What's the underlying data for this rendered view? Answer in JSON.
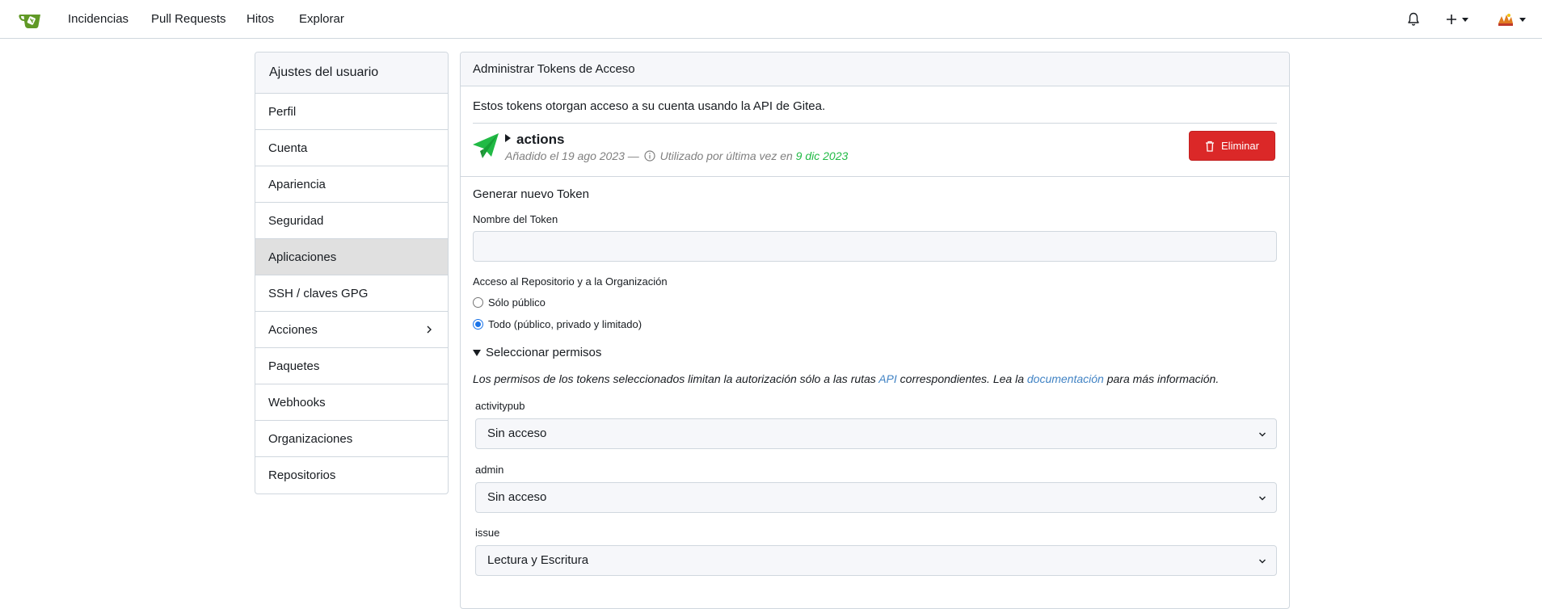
{
  "navbar": {
    "links": [
      "Incidencias",
      "Pull Requests",
      "Hitos",
      "Explorar"
    ],
    "icons": [
      "gitea-logo-icon",
      "bell-icon",
      "plus-icon",
      "avatar"
    ]
  },
  "sidebar": {
    "title": "Ajustes del usuario",
    "items": [
      {
        "label": "Perfil"
      },
      {
        "label": "Cuenta"
      },
      {
        "label": "Apariencia"
      },
      {
        "label": "Seguridad"
      },
      {
        "label": "Aplicaciones",
        "active": true
      },
      {
        "label": "SSH / claves GPG"
      },
      {
        "label": "Acciones",
        "has_submenu": true
      },
      {
        "label": "Paquetes"
      },
      {
        "label": "Webhooks"
      },
      {
        "label": "Organizaciones"
      },
      {
        "label": "Repositorios"
      }
    ]
  },
  "panel": {
    "title": "Administrar Tokens de Acceso",
    "intro": "Estos tokens otorgan acceso a su cuenta usando la API de Gitea.",
    "token": {
      "name": "actions",
      "added": "Añadido el 19 ago 2023 —",
      "last_used_label": "Utilizado por última vez en",
      "last_used_date": "9 dic 2023",
      "delete_label": "Eliminar"
    },
    "generate": {
      "title": "Generar nuevo Token",
      "name_label": "Nombre del Token",
      "name_value": "",
      "access_label": "Acceso al Repositorio y a la Organización",
      "access_options": [
        {
          "label": "Sólo público",
          "checked": false
        },
        {
          "label": "Todo (público, privado y limitado)",
          "checked": true
        }
      ],
      "permissions_toggle": "Seleccionar permisos",
      "help_prefix": "Los permisos de los tokens seleccionados limitan la autorización sólo a las rutas",
      "help_api": "API",
      "help_middle": "correspondientes. Lea la",
      "help_doc": "documentación",
      "help_suffix": "para más información.",
      "permissions": [
        {
          "scope": "activitypub",
          "value": "Sin acceso"
        },
        {
          "scope": "admin",
          "value": "Sin acceso"
        },
        {
          "scope": "issue",
          "value": "Lectura y Escritura"
        }
      ]
    }
  },
  "colors": {
    "danger": "#db2828",
    "accent_green": "#21ba45",
    "link": "#4183c4",
    "logo_green": "#609926"
  }
}
